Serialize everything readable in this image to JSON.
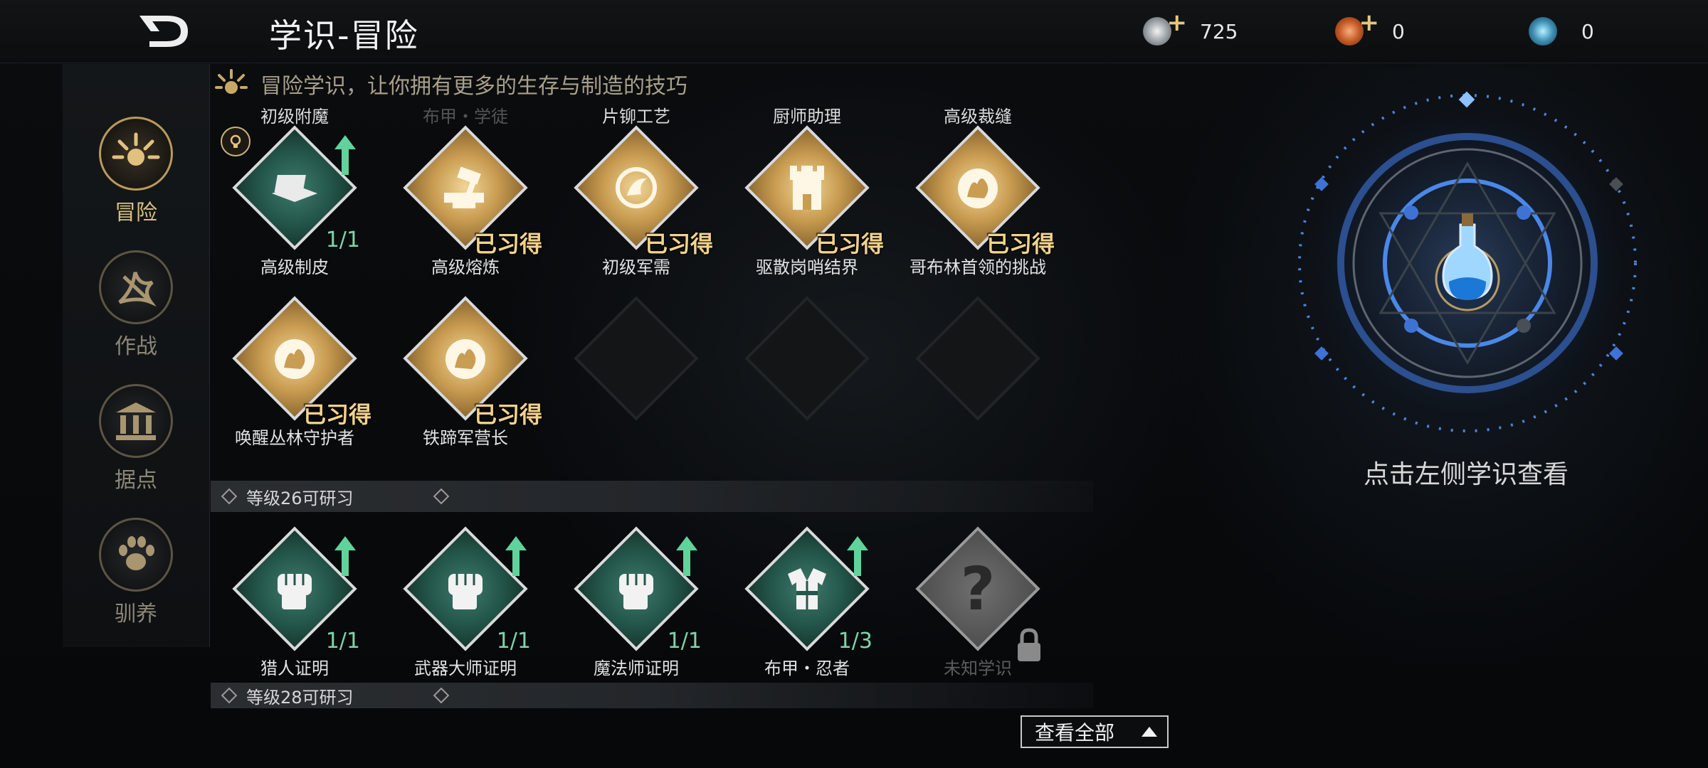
{
  "header": {
    "title": "学识-冒险",
    "currencies": [
      {
        "icon": "silver-coin-icon",
        "value": "725",
        "has_plus": true,
        "color": "#b9bdc2"
      },
      {
        "icon": "copper-coin-icon",
        "value": "0",
        "has_plus": true,
        "color": "#d0733b"
      },
      {
        "icon": "crystal-orb-icon",
        "value": "0",
        "has_plus": false,
        "color": "#5fa8c9"
      }
    ],
    "plus_symbol": "+"
  },
  "nav": {
    "items": [
      {
        "label": "冒险",
        "icon": "sun-feather-icon",
        "active": true
      },
      {
        "label": "作战",
        "icon": "dragon-claw-icon",
        "active": false
      },
      {
        "label": "据点",
        "icon": "temple-icon",
        "active": false
      },
      {
        "label": "驯养",
        "icon": "paw-icon",
        "active": false
      }
    ]
  },
  "intro": {
    "text": "冒险学识，让你拥有更多的生存与制造的技巧"
  },
  "grid": {
    "top_labels": [
      "初级附魔",
      "布甲・学徒",
      "片铆工艺",
      "厨师助理",
      "高级裁缝"
    ],
    "row1": [
      {
        "name": "高级制皮",
        "style": "green",
        "icon": "leather-workbench-icon",
        "progress": "1/1",
        "upgrade": true,
        "hint": true
      },
      {
        "name": "高级熔炼",
        "style": "gold",
        "icon": "anvil-hammer-icon",
        "learned": "已习得"
      },
      {
        "name": "初级军需",
        "style": "gold",
        "icon": "dragon-emblem-icon",
        "learned": "已习得"
      },
      {
        "name": "驱散岗哨结界",
        "style": "gold",
        "icon": "watchtower-icon",
        "learned": "已习得"
      },
      {
        "name": "哥布林首领的挑战",
        "style": "gold",
        "icon": "wolf-head-icon",
        "learned": "已习得"
      }
    ],
    "row2": [
      {
        "name": "唤醒丛林守护者",
        "style": "gold",
        "icon": "wolf-head-icon",
        "learned": "已习得"
      },
      {
        "name": "铁蹄军营长",
        "style": "gold",
        "icon": "wolf-head-icon",
        "learned": "已习得"
      },
      {
        "name": "",
        "style": "empty"
      },
      {
        "name": "",
        "style": "empty"
      },
      {
        "name": "",
        "style": "empty"
      }
    ]
  },
  "sections": [
    {
      "label": "等级26可研习"
    },
    {
      "label": "等级28可研习"
    }
  ],
  "grid2": {
    "row1": [
      {
        "name": "猎人证明",
        "style": "green",
        "icon": "fist-icon",
        "progress": "1/1",
        "upgrade": true
      },
      {
        "name": "武器大师证明",
        "style": "green",
        "icon": "fist-icon",
        "progress": "1/1",
        "upgrade": true
      },
      {
        "name": "魔法师证明",
        "style": "green",
        "icon": "fist-icon",
        "progress": "1/1",
        "upgrade": true
      },
      {
        "name": "布甲・忍者",
        "style": "green",
        "icon": "robe-icon",
        "progress": "1/3",
        "upgrade": true
      },
      {
        "name": "未知学识",
        "style": "grey",
        "icon": "question-mark-icon",
        "locked": true,
        "question": "?"
      }
    ]
  },
  "footer": {
    "view_all": "查看全部"
  },
  "right_panel": {
    "hint": "点击左侧学识查看",
    "icon": "potion-flask-icon"
  }
}
